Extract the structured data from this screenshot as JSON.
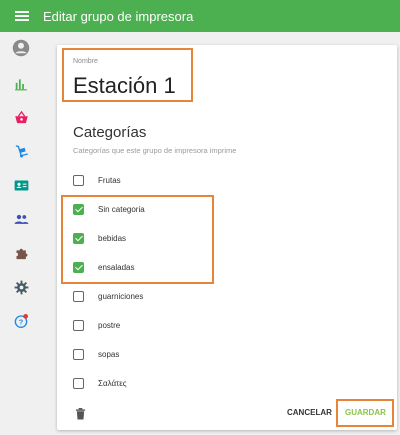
{
  "header": {
    "title": "Editar grupo de impresora"
  },
  "sidebar": {
    "items": [
      {
        "icon": "account-circle-icon"
      },
      {
        "icon": "bar-chart-icon"
      },
      {
        "icon": "basket-icon"
      },
      {
        "icon": "dolly-icon"
      },
      {
        "icon": "contact-card-icon"
      },
      {
        "icon": "people-icon"
      },
      {
        "icon": "puzzle-icon"
      },
      {
        "icon": "gear-icon"
      },
      {
        "icon": "help-icon"
      }
    ]
  },
  "form": {
    "name_label": "Nombre",
    "name_value": "Estación 1",
    "categories_title": "Categorías",
    "categories_subtitle": "Categorías que este grupo de impresora imprime",
    "categories": [
      {
        "label": "Frutas",
        "checked": false
      },
      {
        "label": "Sin categoria",
        "checked": true
      },
      {
        "label": "bebidas",
        "checked": true
      },
      {
        "label": "ensaladas",
        "checked": true
      },
      {
        "label": "guarniciones",
        "checked": false
      },
      {
        "label": "postre",
        "checked": false
      },
      {
        "label": "sopas",
        "checked": false
      },
      {
        "label": "Σαλάτες",
        "checked": false
      }
    ]
  },
  "actions": {
    "cancel_label": "CANCELAR",
    "save_label": "GUARDAR"
  },
  "colors": {
    "primary": "#4caf50",
    "highlight": "#e8833a",
    "save": "#8bc34a"
  }
}
